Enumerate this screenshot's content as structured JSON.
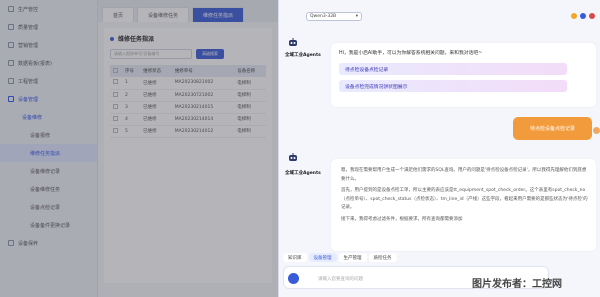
{
  "sidebar": {
    "items": [
      {
        "label": "生产管控",
        "type": "top"
      },
      {
        "label": "质量管理",
        "type": "top"
      },
      {
        "label": "营销管理",
        "type": "top"
      },
      {
        "label": "数据看板(报表)",
        "type": "top"
      },
      {
        "label": "工程管理",
        "type": "top"
      },
      {
        "label": "设备管理",
        "type": "top",
        "active": true
      },
      {
        "label": "设备维修",
        "type": "sub",
        "active": true
      },
      {
        "label": "设备报修",
        "type": "sub2"
      },
      {
        "label": "维修任务指派",
        "type": "sub2",
        "selected": true
      },
      {
        "label": "设备维修记录",
        "type": "sub2"
      },
      {
        "label": "设备维修任务",
        "type": "sub2"
      },
      {
        "label": "设备点检记录",
        "type": "sub2"
      },
      {
        "label": "设备备件更换记录",
        "type": "sub2"
      },
      {
        "label": "设备保养",
        "type": "top"
      }
    ]
  },
  "main": {
    "tabs": [
      "首页",
      "设备维修任务",
      "维修任务指派"
    ],
    "active_tab": 2,
    "panel_title": "维修任务指派",
    "search_placeholder": "请输入报修单号/设备编号",
    "search_button": "高级搜索",
    "columns": [
      "",
      "序号",
      "维修状态",
      "维修单号",
      "设备名称"
    ],
    "rows": [
      [
        "1",
        "已维修",
        "MA20230821002",
        "电梯制"
      ],
      [
        "2",
        "已维修",
        "MA20230721002",
        "电梯制"
      ],
      [
        "3",
        "已维修",
        "MA20230214015",
        "电梯制"
      ],
      [
        "4",
        "已维修",
        "MA20230214014",
        "电梯制"
      ],
      [
        "5",
        "已维修",
        "MA20230214012",
        "电梯制"
      ]
    ]
  },
  "chat": {
    "model": "Qwen3-32B",
    "bot_name": "全域工业Agents",
    "greeting": "Hi，我是小启AI助手，可以为你解答系统相关问题，来和我对话吧~",
    "suggestions": [
      "待点检设备点检记录",
      "设备点检完成情况饼状图展示"
    ],
    "user_message": "待点检设备点检记录",
    "paragraphs": [
      "嗯，我现在需要帮用户生成一个满足他们需求的SQL查询。用户的问题是'待点检设备点检记录'，所以我得先理解他们到底想要什么。",
      "首先，用户提到的是设备点检工单，所以主要的表应该是tt_equipment_spot_check_order。这个表里有spot_check_no（点检单号）、spot_check_status（点检状态）、tm_line_id（产线）这些字段，看起来用户需要的是那些状态为'待点检'的记录。",
      "接下来，我得考虑过滤条件，根据要求，所有查询都需要添加"
    ],
    "quick_actions": [
      "知识库",
      "设备管理",
      "生产管理",
      "质检任务"
    ],
    "active_quick": 1,
    "input_placeholder": "请输入您要查询的问题"
  },
  "watermark": "图片发布者：工控网",
  "colors": {
    "accent": "#3a5bd9",
    "user_bubble": "#f29b3c",
    "suggestion_text": "#3b39b8"
  }
}
